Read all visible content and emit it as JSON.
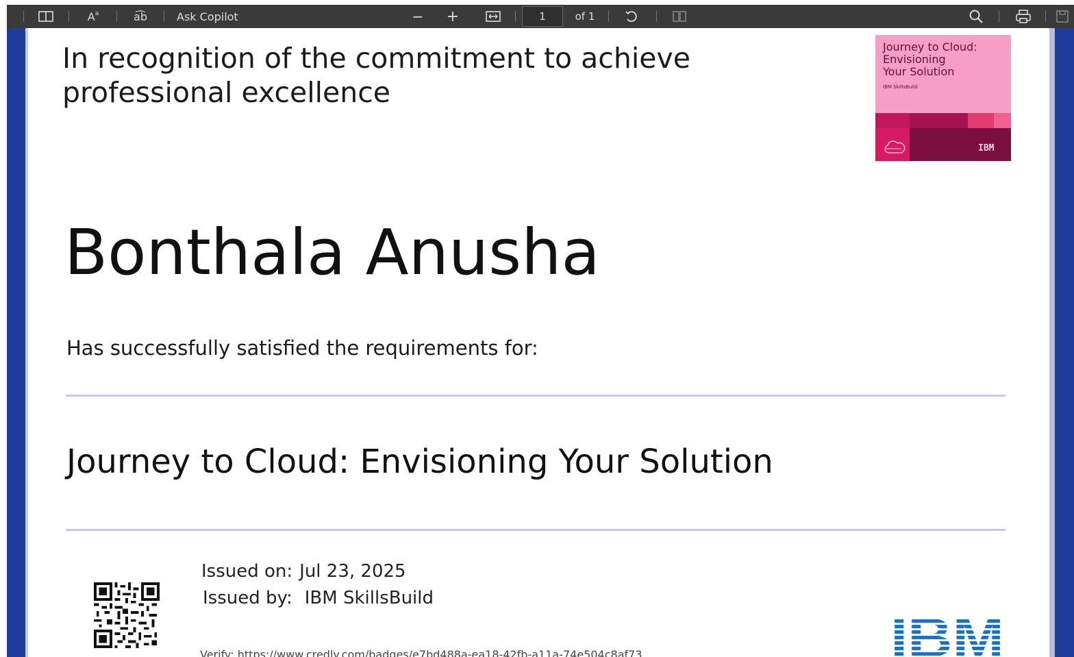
{
  "toolbar": {
    "font_size_label": "A",
    "read_aloud_label": "a͡b",
    "ask_copilot_label": "Ask Copilot",
    "zoom_out_label": "−",
    "zoom_in_label": "+",
    "current_page": "1",
    "page_count_label": "of 1",
    "icons": [
      "table-of-contents-icon",
      "text-size-icon",
      "read-aloud-icon",
      "fit-page-icon",
      "rotate-icon",
      "two-page-icon",
      "search-icon",
      "print-icon",
      "save-icon"
    ],
    "background_color": "#3a3a3a"
  },
  "frame": {
    "accent_color": "#1e3d9a"
  },
  "certificate": {
    "recognition_line1": "In recognition of the commitment to achieve",
    "recognition_line2": "professional excellence",
    "recipient_name": "Bonthala Anusha",
    "satisfied_text": "Has successfully satisfied the requirements for:",
    "course_title": "Journey to Cloud: Envisioning Your Solution",
    "issued_on_label": "Issued on:",
    "issued_on_value": "Jul 23, 2025",
    "issued_by_label": "Issued by:",
    "issued_by_value": "IBM SkillsBuild",
    "verify_text": "Verify:  https://www.credly.com/badges/e7bd488a-ea18-42fb-a11a-74e504c8af73",
    "issuer_logo": "IBM"
  },
  "badge": {
    "title_line1": "Journey to Cloud:",
    "title_line2": "Envisioning",
    "title_line3": "Your Solution",
    "subtitle": "IBM SkillsBuild",
    "brand": "IBM",
    "background_color": "#f79ec4",
    "band_color": "#7a0f3d"
  }
}
